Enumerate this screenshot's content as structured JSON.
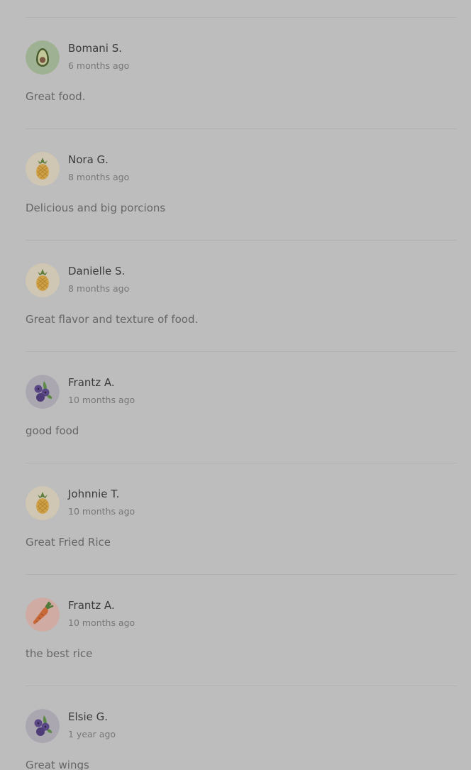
{
  "reviews": [
    {
      "name": "Bomani S.",
      "time": "6 months ago",
      "text": "Great food.",
      "avatar": "avocado-icon"
    },
    {
      "name": "Nora G.",
      "time": "8 months ago",
      "text": "Delicious and big porcions",
      "avatar": "pineapple-icon"
    },
    {
      "name": "Danielle S.",
      "time": "8 months ago",
      "text": "Great flavor and texture of food.",
      "avatar": "pineapple-icon"
    },
    {
      "name": "Frantz A.",
      "time": "10 months ago",
      "text": "good food",
      "avatar": "blueberries-icon"
    },
    {
      "name": "Johnnie T.",
      "time": "10 months ago",
      "text": "Great Fried Rice",
      "avatar": "pineapple-icon"
    },
    {
      "name": "Frantz A.",
      "time": "10 months ago",
      "text": "the best rice",
      "avatar": "carrot-icon"
    },
    {
      "name": "Elsie G.",
      "time": "1 year ago",
      "text": "Great wings",
      "avatar": "blueberries-icon"
    }
  ],
  "colors": {
    "overlay_background": "#bdbdbd",
    "divider": "#b1b1b1",
    "avatar_avocado_bg": "#9fb193",
    "avatar_pineapple_bg": "#cfc6b3",
    "avatar_blueberries_bg": "#aaa7b0",
    "avatar_carrot_bg": "#cfaba3"
  }
}
